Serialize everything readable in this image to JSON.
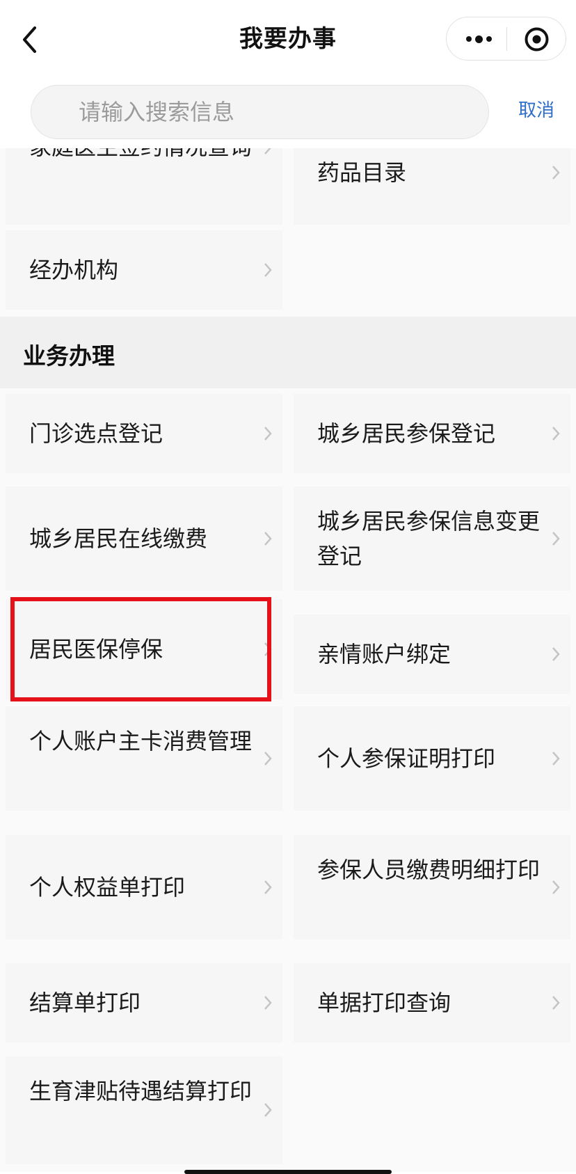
{
  "header": {
    "title": "我要办事"
  },
  "search": {
    "placeholder": "请输入搜索信息",
    "value": "",
    "cancel_label": "取消"
  },
  "top_items": [
    {
      "label": "家庭医生签约情况查询"
    },
    {
      "label": "药品目录"
    },
    {
      "label": "经办机构"
    }
  ],
  "section": {
    "title": "业务办理",
    "items": [
      {
        "label": "门诊选点登记"
      },
      {
        "label": "城乡居民参保登记"
      },
      {
        "label": "城乡居民在线缴费"
      },
      {
        "label": "城乡居民参保信息变更登记"
      },
      {
        "label": "居民医保停保"
      },
      {
        "label": "亲情账户绑定"
      },
      {
        "label": "个人账户主卡消费管理"
      },
      {
        "label": "个人参保证明打印"
      },
      {
        "label": "个人权益单打印"
      },
      {
        "label": "参保人员缴费明细打印"
      },
      {
        "label": "结算单打印"
      },
      {
        "label": "单据打印查询"
      },
      {
        "label": "生育津贴待遇结算打印"
      }
    ]
  },
  "colors": {
    "accent_link": "#2f6ec8",
    "highlight": "#e5121a",
    "card_bg": "#f6f6f6"
  }
}
